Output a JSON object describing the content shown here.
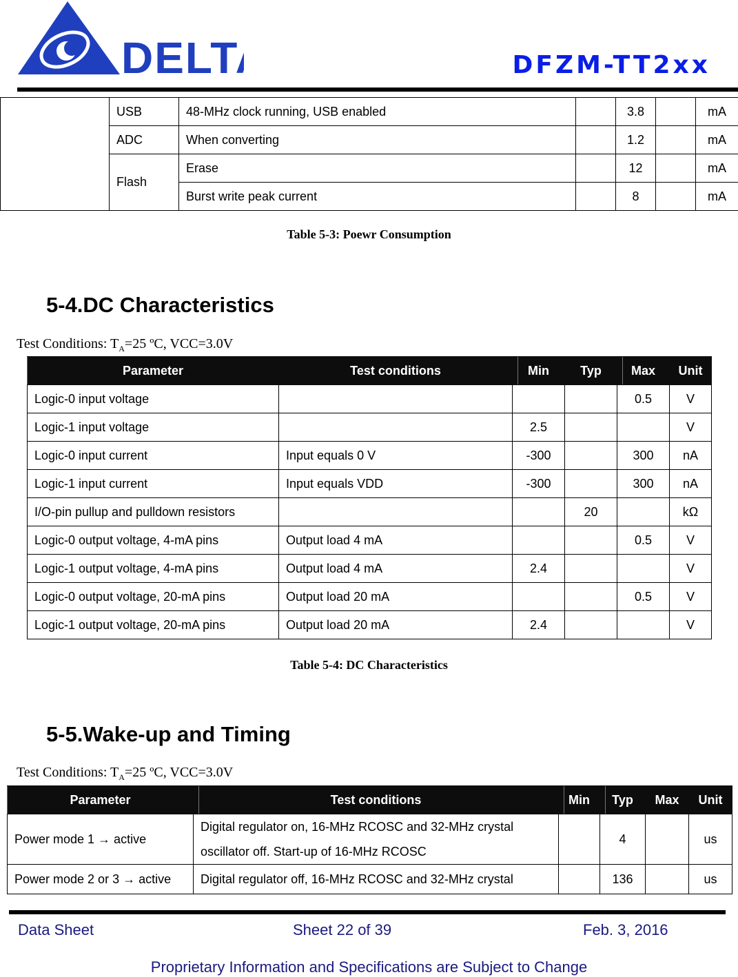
{
  "header": {
    "logo_text": "DELTA",
    "doc_code": "DFZM-TT2xx",
    "colors": {
      "logo_blue": "#1f3fbf",
      "doc_code_blue": "#0a1ee6",
      "footer_text": "#1a1a80"
    }
  },
  "power_table": {
    "rows": [
      {
        "module": "USB",
        "condition": "48-MHz clock running, USB enabled",
        "min": "",
        "typ": "3.8",
        "max": "",
        "unit": "mA"
      },
      {
        "module": "ADC",
        "condition": "When converting",
        "min": "",
        "typ": "1.2",
        "max": "",
        "unit": "mA"
      },
      {
        "module": "Flash",
        "condition": "Erase",
        "min": "",
        "typ": "12",
        "max": "",
        "unit": "mA"
      },
      {
        "module": "",
        "condition": "Burst write peak current",
        "min": "",
        "typ": "8",
        "max": "",
        "unit": "mA"
      }
    ],
    "caption": "Table 5-3: Poewr Consumption"
  },
  "dc_section": {
    "title": "5-4.DC Characteristics",
    "test_conditions_prefix": "Test Conditions: T",
    "test_conditions_sub": "A",
    "test_conditions_suffix": "=25 ºC, VCC=3.0V",
    "headers": [
      "Parameter",
      "Test conditions",
      "Min",
      "Typ",
      "Max",
      "Unit"
    ],
    "rows": [
      {
        "parameter": "Logic-0 input voltage",
        "condition": "",
        "min": "",
        "typ": "",
        "max": "0.5",
        "unit": "V"
      },
      {
        "parameter": "Logic-1 input voltage",
        "condition": "",
        "min": "2.5",
        "typ": "",
        "max": "",
        "unit": "V"
      },
      {
        "parameter": "Logic-0 input current",
        "condition": "Input equals 0 V",
        "min": "-300",
        "typ": "",
        "max": "300",
        "unit": "nA"
      },
      {
        "parameter": "Logic-1 input current",
        "condition": "Input equals VDD",
        "min": "-300",
        "typ": "",
        "max": "300",
        "unit": "nA"
      },
      {
        "parameter": "I/O-pin pullup and pulldown resistors",
        "condition": "",
        "min": "",
        "typ": "20",
        "max": "",
        "unit": "kΩ"
      },
      {
        "parameter": "Logic-0 output voltage, 4-mA pins",
        "condition": "Output load 4 mA",
        "min": "",
        "typ": "",
        "max": "0.5",
        "unit": "V"
      },
      {
        "parameter": "Logic-1 output voltage, 4-mA pins",
        "condition": "Output load 4 mA",
        "min": "2.4",
        "typ": "",
        "max": "",
        "unit": "V"
      },
      {
        "parameter": "Logic-0 output voltage, 20-mA pins",
        "condition": "Output load 20 mA",
        "min": "",
        "typ": "",
        "max": "0.5",
        "unit": "V"
      },
      {
        "parameter": "Logic-1 output voltage, 20-mA pins",
        "condition": "Output load 20 mA",
        "min": "2.4",
        "typ": "",
        "max": "",
        "unit": "V"
      }
    ],
    "caption": "Table 5-4: DC Characteristics"
  },
  "timing_section": {
    "title": "5-5.Wake-up and Timing",
    "test_conditions_prefix": "Test Conditions: T",
    "test_conditions_sub": "A",
    "test_conditions_suffix": "=25 ºC, VCC=3.0V",
    "headers": [
      "Parameter",
      "Test conditions",
      "Min",
      "Typ",
      "Max",
      "Unit"
    ],
    "rows": [
      {
        "parameter": "Power mode 1 → active",
        "condition_line1": "Digital regulator on, 16-MHz RCOSC and 32-MHz crystal",
        "condition_line2": "oscillator off. Start-up of 16-MHz RCOSC",
        "min": "",
        "typ": "4",
        "max": "",
        "unit": "us"
      },
      {
        "parameter": "Power mode 2 or 3 → active",
        "condition_line1": "Digital regulator off, 16-MHz RCOSC and 32-MHz crystal",
        "condition_line2": "",
        "min": "",
        "typ": "136",
        "max": "",
        "unit": "us"
      }
    ]
  },
  "footer": {
    "left": "Data Sheet",
    "center": "Sheet 22 of 39",
    "right": "Feb. 3, 2016",
    "note": "Proprietary Information and Specifications are Subject to Change"
  }
}
